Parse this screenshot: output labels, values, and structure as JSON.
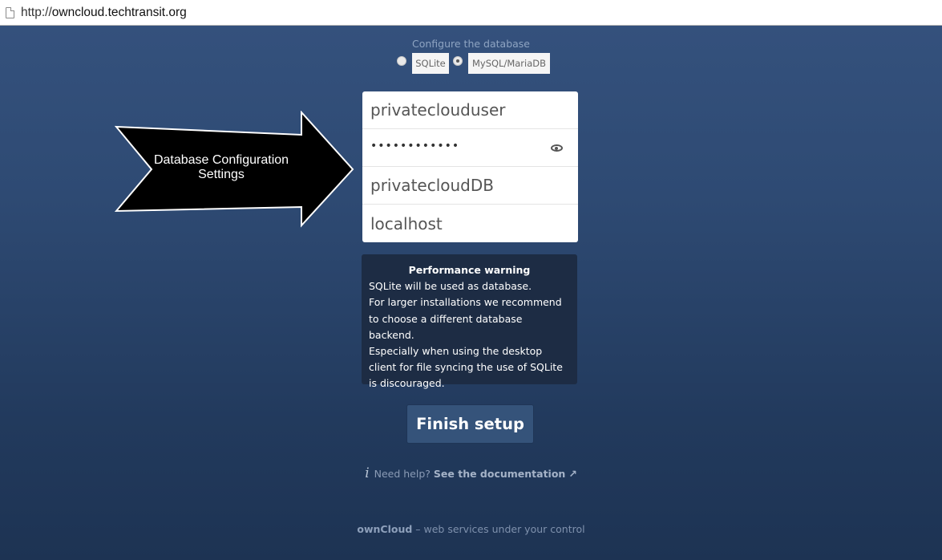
{
  "browser": {
    "url_scheme": "http://",
    "url_host": "owncloud.techtransit.org"
  },
  "database": {
    "title": "Configure the database",
    "options": [
      {
        "label": "SQLite",
        "selected": false
      },
      {
        "label": "MySQL/MariaDB",
        "selected": true
      }
    ]
  },
  "fields": {
    "db_user": "privateclouduser",
    "db_password_mask": "••••••••••••",
    "db_name": "privatecloudDB",
    "db_host": "localhost"
  },
  "icons": {
    "password": "eye-icon",
    "help": "info-icon",
    "external": "external-link-icon"
  },
  "callout": {
    "text": "Database Configuration Settings"
  },
  "warning": {
    "title": "Performance warning",
    "line1": "SQLite will be used as database.",
    "line2": "For larger installations we recommend to choose a different database backend.",
    "line3": "Especially when using the desktop client for file syncing the use of SQLite is discouraged."
  },
  "finish_button": "Finish setup",
  "help": {
    "prefix": "Need help?",
    "link": "See the documentation",
    "arrow": "↗"
  },
  "footer": {
    "brand": "ownCloud",
    "tagline": "– web services under your control"
  },
  "colors": {
    "background_top": "#35527e",
    "background_bottom": "#1d3353",
    "warning_bg": "#1d2c44",
    "button_bg": "#35537a"
  }
}
